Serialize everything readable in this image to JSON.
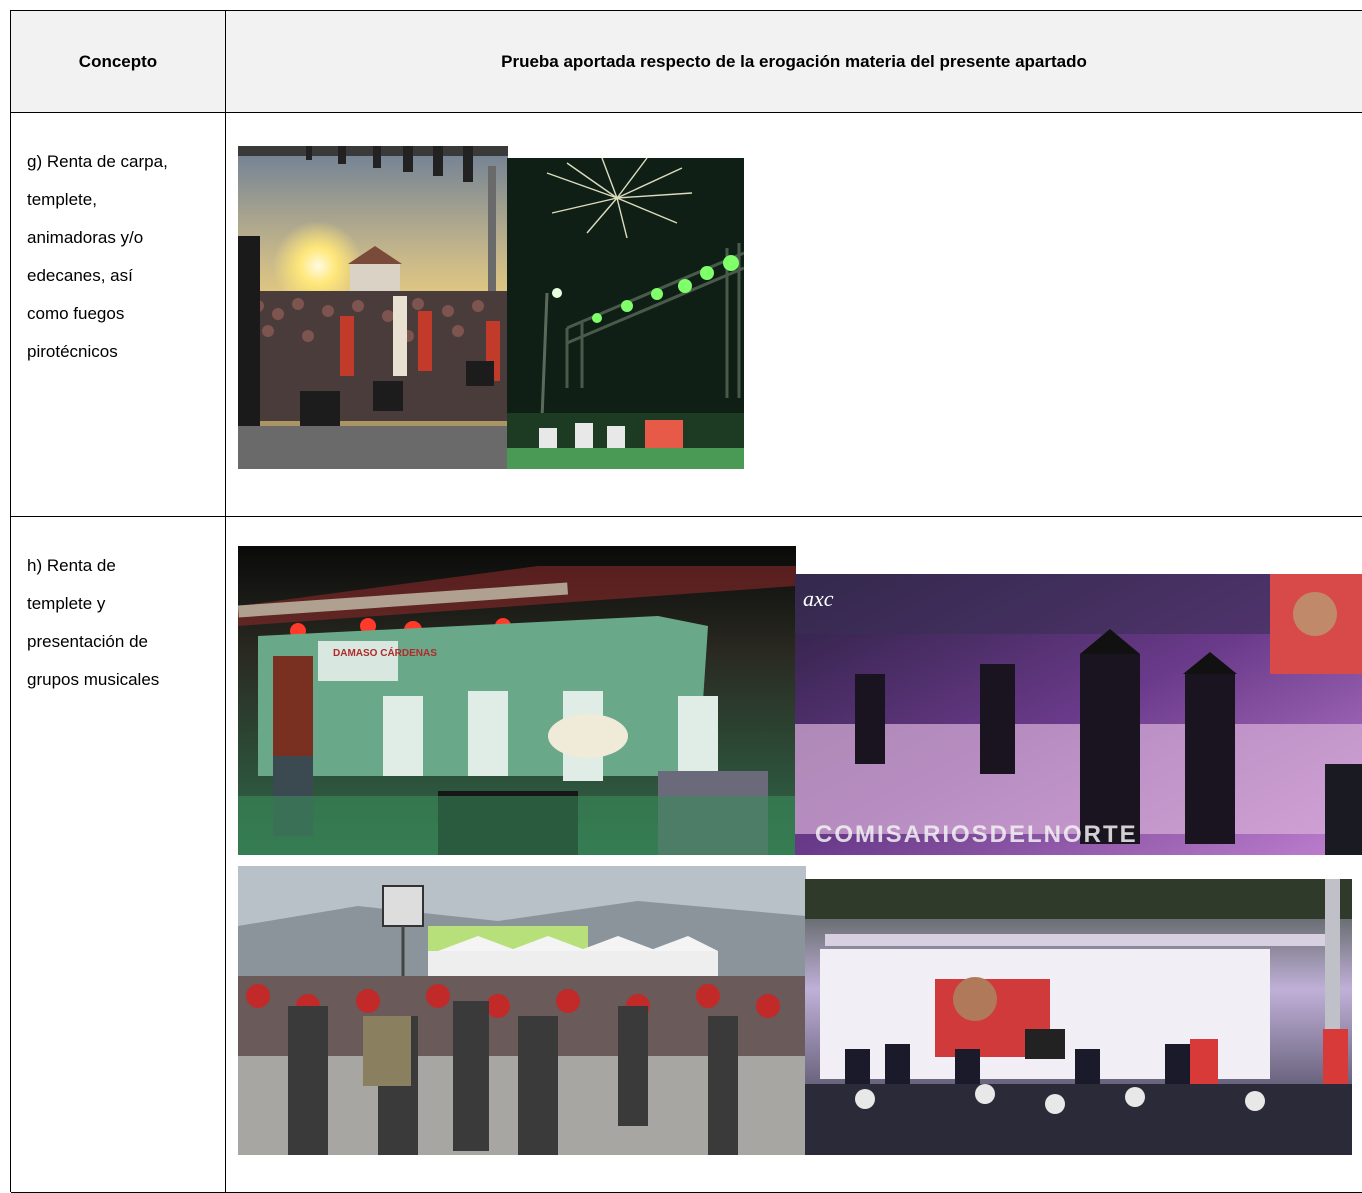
{
  "table": {
    "headers": {
      "concept": "Concepto",
      "evidence": "Prueba aportada respecto de la erogación materia del presente apartado"
    },
    "rows": [
      {
        "concept_lines": [
          "g) Renta de carpa,",
          "templete,",
          "animadoras y/o",
          "edecanes, así",
          "como fuegos",
          "pirotécnicos"
        ],
        "photos": [
          "concert-sunset-dancers-photo",
          "fireworks-green-stage-photo"
        ]
      },
      {
        "concept_lines": [
          "h) Renta de",
          "templete y",
          "presentación de",
          "grupos musicales"
        ],
        "photos": [
          "mariachi-stage-photo",
          "nortenos-purple-stage-photo",
          "crowd-outdoor-event-photo",
          "stage-banner-band-photo"
        ],
        "overlay_text": {
          "axc_logo": "axc",
          "watermark": "COMISARIOSDELNORTE",
          "banner": "DAMASO CÁRDENAS"
        }
      }
    ]
  }
}
